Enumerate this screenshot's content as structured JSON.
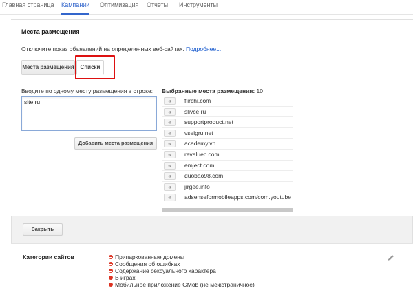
{
  "nav": {
    "tabs": [
      {
        "label": "Главная страница"
      },
      {
        "label": "Кампании"
      },
      {
        "label": "Оптимизация"
      },
      {
        "label": "Отчеты"
      },
      {
        "label": "Инструменты"
      }
    ],
    "active_tab": "Кампании"
  },
  "panel": {
    "title": "Места размещения",
    "description": "Отключите показ объявлений на определенных веб-сайтах.",
    "more_link": "Подробнее...",
    "subtabs": [
      {
        "label": "Места размещения"
      },
      {
        "label": "Списки"
      }
    ],
    "current_subtab": "Списки"
  },
  "entry": {
    "label": "Вводите по одному месту размещения в строке:",
    "value": "site.ru",
    "add_button": "Добавить места размещения"
  },
  "selected": {
    "label": "Выбранные места размещения:",
    "count": "10",
    "items": [
      "flirchi.com",
      "slivce.ru",
      "supportproduct.net",
      "vseigru.net",
      "academy.vn",
      "revaluec.com",
      "emject.com",
      "duobao98.com",
      "jirgee.info",
      "adsenseformobileapps.com/com.youtube"
    ],
    "arrow_glyph": "«"
  },
  "close_button": "Закрыть",
  "categories": {
    "title": "Категории сайтов",
    "items": [
      "Припаркованные домены",
      "Сообщения об ошибках",
      "Содержание сексуального характера",
      "В играх",
      "Мобильное приложение GMob (не межстраничное)"
    ]
  },
  "colors": {
    "accent": "#3366cc",
    "link": "#1155cc",
    "highlight": "#dd1111",
    "remove_dot": "#dd3322"
  },
  "icons": {
    "edit": "pencil-icon",
    "remove": "remove-circle-icon"
  }
}
